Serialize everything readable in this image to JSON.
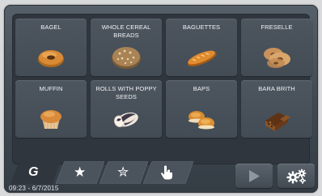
{
  "products": [
    {
      "label": "BAGEL",
      "icon": "bagel-icon"
    },
    {
      "label": "WHOLE CEREAL BREADS",
      "icon": "whole-cereal-bread-icon"
    },
    {
      "label": "BAGUETTES",
      "icon": "baguette-icon"
    },
    {
      "label": "FRESELLE",
      "icon": "freselle-icon"
    },
    {
      "label": "MUFFIN",
      "icon": "muffin-icon"
    },
    {
      "label": "ROLLS WITH POPPY SEEDS",
      "icon": "poppy-seed-roll-icon"
    },
    {
      "label": "BAPS",
      "icon": "baps-icon"
    },
    {
      "label": "BARA BRITH",
      "icon": "bara-brith-icon"
    }
  ],
  "tabs": [
    {
      "name": "tab-brand",
      "icon": "brand-logo-icon",
      "active": true
    },
    {
      "name": "tab-favorites",
      "icon": "star-icon",
      "active": false
    },
    {
      "name": "tab-favorites-outline",
      "icon": "star-outline-icon",
      "active": false
    },
    {
      "name": "tab-manual",
      "icon": "hand-pointer-icon",
      "active": false
    }
  ],
  "status": {
    "datetime": "09:23 - 6/7/2015"
  },
  "buttons": {
    "play_icon": "play-icon",
    "settings_icon": "settings-gears-icon"
  },
  "colors": {
    "background": "#3f4851",
    "tile": "#4a535c",
    "text": "#f1f3f5"
  }
}
